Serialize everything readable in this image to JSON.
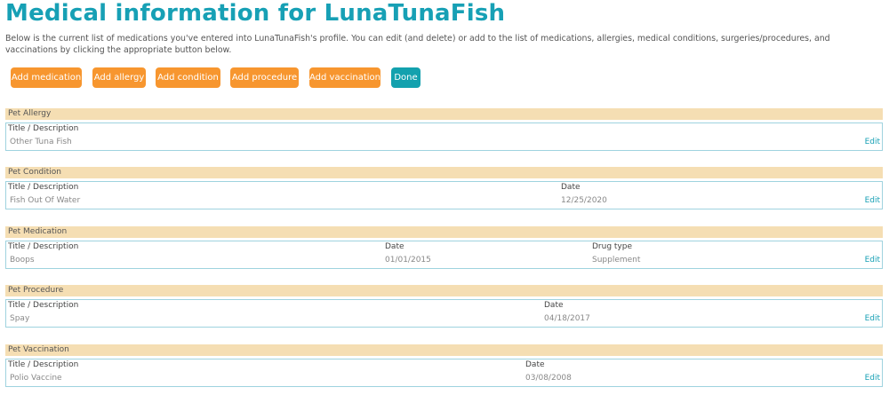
{
  "page": {
    "title": "Medical information for LunaTunaFish",
    "intro": "Below is the current list of medications you've entered into LunaTunaFish's profile. You can edit (and delete) or add to the list of medications, allergies, medical conditions, surgeries/procedures, and vaccinations by clicking the appropriate button below."
  },
  "buttons": {
    "add_medication": "Add medication",
    "add_allergy": "Add allergy",
    "add_condition": "Add condition",
    "add_procedure": "Add procedure",
    "add_vaccination": "Add vaccination",
    "done": "Done"
  },
  "colors": {
    "title": "#17a0b5",
    "orange_button": "#f7962f",
    "done_button": "#13a1ae",
    "section_header": "#f5deb3",
    "box_border": "#9fd3df"
  },
  "sections": {
    "allergy": {
      "header": "Pet Allergy",
      "col_title": "Title / Description",
      "title_value": "Other Tuna Fish",
      "edit": "Edit"
    },
    "condition": {
      "header": "Pet Condition",
      "col_title": "Title / Description",
      "col_date": "Date",
      "title_value": "Fish Out Of Water",
      "date_value": "12/25/2020",
      "edit": "Edit"
    },
    "medication": {
      "header": "Pet Medication",
      "col_title": "Title / Description",
      "col_date": "Date",
      "col_drug_type": "Drug type",
      "title_value": "Boops",
      "date_value": "01/01/2015",
      "drug_type_value": "Supplement",
      "edit": "Edit"
    },
    "procedure": {
      "header": "Pet Procedure",
      "col_title": "Title / Description",
      "col_date": "Date",
      "title_value": "Spay",
      "date_value": "04/18/2017",
      "edit": "Edit"
    },
    "vaccination": {
      "header": "Pet Vaccination",
      "col_title": "Title / Description",
      "col_date": "Date",
      "title_value": "Polio Vaccine",
      "date_value": "03/08/2008",
      "edit": "Edit"
    }
  }
}
